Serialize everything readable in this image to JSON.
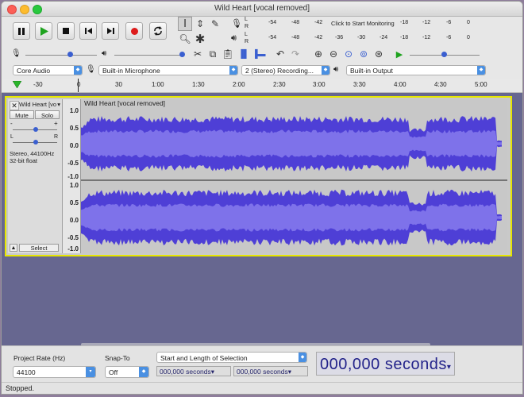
{
  "window": {
    "title": "Wild Heart [vocal removed]"
  },
  "meters": {
    "record": {
      "L": "L",
      "R": "R",
      "scale": [
        "-54",
        "-48",
        "-42",
        "-18",
        "-12",
        "-6",
        "0"
      ],
      "prompt": "Click to Start Monitoring"
    },
    "playback": {
      "L": "L",
      "R": "R",
      "scale": [
        "-54",
        "-48",
        "-42",
        "-36",
        "-30",
        "-24",
        "-18",
        "-12",
        "-6",
        "0"
      ]
    }
  },
  "devices": {
    "host": "Core Audio",
    "input": "Built-in Microphone",
    "channels": "2 (Stereo) Recording...",
    "output": "Built-in Output"
  },
  "ruler": {
    "ticks": [
      "-30",
      "0",
      "30",
      "1:00",
      "1:30",
      "2:00",
      "2:30",
      "3:00",
      "3:30",
      "4:00",
      "4:30",
      "5:00"
    ]
  },
  "track": {
    "name": "Wild Heart [vo",
    "clip_name": "Wild Heart [vocal removed]",
    "mute": "Mute",
    "solo": "Solo",
    "gain_minus": "-",
    "gain_plus": "+",
    "pan_left": "L",
    "pan_right": "R",
    "info_rate": "Stereo, 44100Hz",
    "info_format": "32-bit float",
    "select": "Select",
    "scale": [
      "1.0",
      "0.5",
      "0.0",
      "-0.5",
      "-1.0"
    ]
  },
  "selection": {
    "project_rate_label": "Project Rate (Hz)",
    "project_rate": "44100",
    "snap_label": "Snap-To",
    "snap_value": "Off",
    "mode": "Start and Length of Selection",
    "start": "000,000 seconds",
    "length": "000,000 seconds",
    "audio_position": "000,000 seconds"
  },
  "status": {
    "text": "Stopped."
  },
  "colors": {
    "waveform": "#4e3fd6",
    "waveform_rms": "#7e72ea",
    "track_bg": "#676790",
    "selected_border": "#e7e700"
  }
}
